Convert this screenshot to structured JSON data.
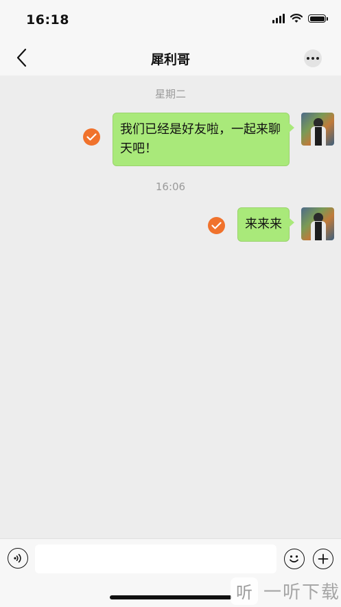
{
  "status_bar": {
    "time": "16:18"
  },
  "nav": {
    "title": "犀利哥"
  },
  "messages": [
    {
      "timestamp": "星期二",
      "text": "我们已经是好友啦，一起来聊天吧！",
      "status": "sent"
    },
    {
      "timestamp": "16:06",
      "text": "来来来",
      "status": "sent"
    }
  ],
  "input": {
    "value": "",
    "placeholder": ""
  },
  "watermark": {
    "box": "听",
    "text": "一听下载"
  },
  "colors": {
    "bubble": "#a9e97a",
    "check": "#f0722c",
    "background": "#ededed"
  }
}
